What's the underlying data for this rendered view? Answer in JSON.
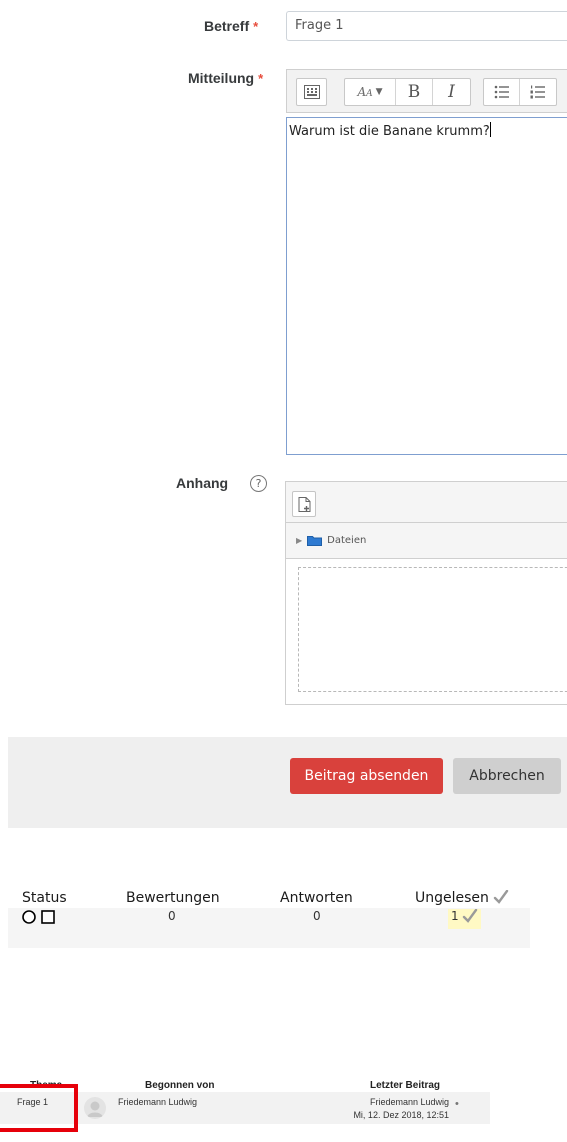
{
  "form": {
    "subject_label": "Betreff",
    "subject_value": "Frage 1",
    "message_label": "Mitteilung",
    "message_text": "Warum ist die Banane krumm?",
    "required_mark": "*",
    "attachment_label": "Anhang",
    "files_folder": "Dateien"
  },
  "editor_toolbar": {
    "bold": "B",
    "italic": "I"
  },
  "buttons": {
    "submit": "Beitrag absenden",
    "cancel": "Abbrechen"
  },
  "status_table": {
    "headers": [
      "Status",
      "Bewertungen",
      "Antworten",
      "Ungelesen"
    ],
    "row": {
      "ratings": "0",
      "replies": "0",
      "unread": "1"
    }
  },
  "forum_list": {
    "headers": [
      "Thema",
      "Begonnen von",
      "Letzter Beitrag"
    ],
    "row": {
      "topic": "Frage 1",
      "started_by": "Friedemann Ludwig",
      "last_post_user": "Friedemann Ludwig",
      "last_post_date": "Mi, 12. Dez 2018, 12:51"
    }
  },
  "colors": {
    "required": "#e74c3c",
    "submit_bg": "#d9413c",
    "highlight_box": "#e6000a",
    "unread_highlight": "#fff9c4"
  }
}
